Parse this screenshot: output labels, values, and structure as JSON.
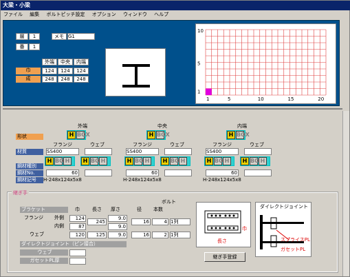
{
  "window": {
    "title": "大梁・小梁"
  },
  "menu": [
    "ファイル",
    "編集",
    "ボルトピッチ設定",
    "オプション",
    "ウィンドウ",
    "ヘルプ"
  ],
  "top": {
    "layer_label": "層",
    "layer_value": "1",
    "memo_label": "メモ",
    "memo_value": "G1",
    "number_label": "番",
    "number_value": "1",
    "headers": [
      "外端",
      "中央",
      "内端"
    ],
    "width_label": "巾",
    "width_values": [
      "124",
      "124",
      "124"
    ],
    "height_label": "成",
    "height_values": [
      "248",
      "248",
      "248"
    ]
  },
  "grid": {
    "y_ticks": [
      "10",
      "5",
      "1"
    ],
    "x_ticks": [
      "1",
      "5",
      "10",
      "15",
      "20"
    ]
  },
  "cols": [
    {
      "title": "外端",
      "flange": "フランジ",
      "web": "ウェブ",
      "material": "SS400",
      "no": "60",
      "size": "H-248x124x5x8"
    },
    {
      "title": "中央",
      "flange": "フランジ",
      "web": "ウェブ",
      "material": "SS400",
      "no": "60",
      "size": "H-248x124x5x8"
    },
    {
      "title": "内端",
      "flange": "フランジ",
      "web": "ウェブ",
      "material": "SS400",
      "no": "60",
      "size": "H-248x124x5x8"
    }
  ],
  "labels": {
    "shape": "形状",
    "material": "材質",
    "type": "鋼材種別",
    "no": "鋼材No.",
    "code": "鋼材記号",
    "joint": "継ぎ手",
    "bracket": "ブラケット",
    "flange": "フランジ",
    "outer": "外側",
    "inner": "内側",
    "web": "ウェブ",
    "direct": "ダイレクトジョイント（ピン接合）",
    "web2": "ウェブ",
    "gusset": "ガセットPL厚",
    "bolt": "ボルト",
    "width_h": "巾",
    "length_h": "長さ",
    "thick_h": "厚さ",
    "dia_h": "径",
    "count_h": "本数",
    "width_tag": "巾",
    "length_tag": "長さ",
    "direct_title": "ダイレクトジョイント",
    "splice_pl": "スプライスPL",
    "gusset_pl": "ガセットPL",
    "button": "継ぎ手登録",
    "btn_h": "H",
    "btn_box": "BOX"
  },
  "joint_rows": {
    "flange_outer": {
      "w": "124",
      "l": "245",
      "t": "9.0",
      "d": "16",
      "n": "4",
      "sel": "1列"
    },
    "flange_inner": {
      "w": "87",
      "t": "9.0"
    },
    "web": {
      "w": "120",
      "l": "125",
      "t": "9.0",
      "d": "16",
      "n": "2",
      "sel": "1列"
    }
  }
}
